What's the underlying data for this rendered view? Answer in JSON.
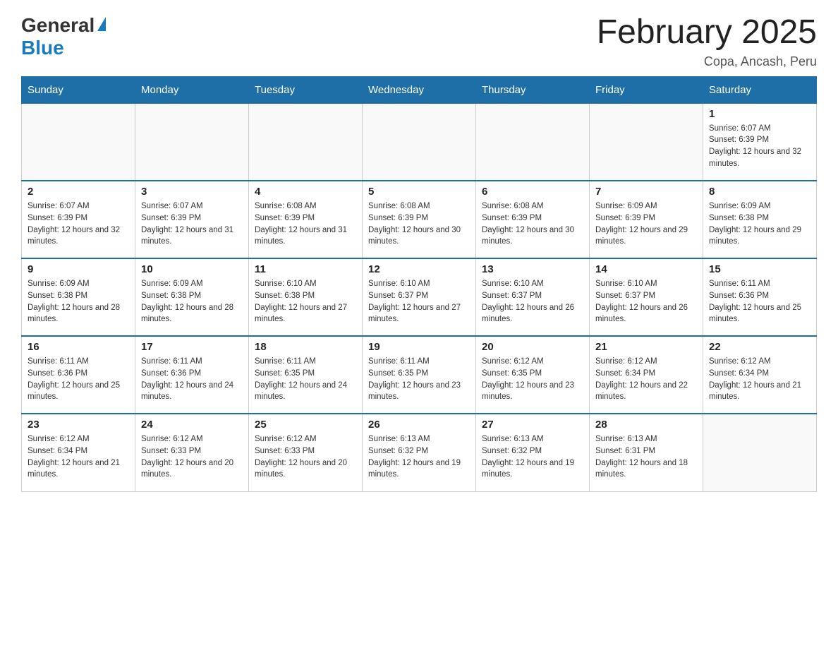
{
  "header": {
    "logo_general": "General",
    "logo_blue": "Blue",
    "month_title": "February 2025",
    "location": "Copa, Ancash, Peru"
  },
  "days_of_week": [
    "Sunday",
    "Monday",
    "Tuesday",
    "Wednesday",
    "Thursday",
    "Friday",
    "Saturday"
  ],
  "weeks": [
    [
      {
        "day": "",
        "info": ""
      },
      {
        "day": "",
        "info": ""
      },
      {
        "day": "",
        "info": ""
      },
      {
        "day": "",
        "info": ""
      },
      {
        "day": "",
        "info": ""
      },
      {
        "day": "",
        "info": ""
      },
      {
        "day": "1",
        "info": "Sunrise: 6:07 AM\nSunset: 6:39 PM\nDaylight: 12 hours and 32 minutes."
      }
    ],
    [
      {
        "day": "2",
        "info": "Sunrise: 6:07 AM\nSunset: 6:39 PM\nDaylight: 12 hours and 32 minutes."
      },
      {
        "day": "3",
        "info": "Sunrise: 6:07 AM\nSunset: 6:39 PM\nDaylight: 12 hours and 31 minutes."
      },
      {
        "day": "4",
        "info": "Sunrise: 6:08 AM\nSunset: 6:39 PM\nDaylight: 12 hours and 31 minutes."
      },
      {
        "day": "5",
        "info": "Sunrise: 6:08 AM\nSunset: 6:39 PM\nDaylight: 12 hours and 30 minutes."
      },
      {
        "day": "6",
        "info": "Sunrise: 6:08 AM\nSunset: 6:39 PM\nDaylight: 12 hours and 30 minutes."
      },
      {
        "day": "7",
        "info": "Sunrise: 6:09 AM\nSunset: 6:39 PM\nDaylight: 12 hours and 29 minutes."
      },
      {
        "day": "8",
        "info": "Sunrise: 6:09 AM\nSunset: 6:38 PM\nDaylight: 12 hours and 29 minutes."
      }
    ],
    [
      {
        "day": "9",
        "info": "Sunrise: 6:09 AM\nSunset: 6:38 PM\nDaylight: 12 hours and 28 minutes."
      },
      {
        "day": "10",
        "info": "Sunrise: 6:09 AM\nSunset: 6:38 PM\nDaylight: 12 hours and 28 minutes."
      },
      {
        "day": "11",
        "info": "Sunrise: 6:10 AM\nSunset: 6:38 PM\nDaylight: 12 hours and 27 minutes."
      },
      {
        "day": "12",
        "info": "Sunrise: 6:10 AM\nSunset: 6:37 PM\nDaylight: 12 hours and 27 minutes."
      },
      {
        "day": "13",
        "info": "Sunrise: 6:10 AM\nSunset: 6:37 PM\nDaylight: 12 hours and 26 minutes."
      },
      {
        "day": "14",
        "info": "Sunrise: 6:10 AM\nSunset: 6:37 PM\nDaylight: 12 hours and 26 minutes."
      },
      {
        "day": "15",
        "info": "Sunrise: 6:11 AM\nSunset: 6:36 PM\nDaylight: 12 hours and 25 minutes."
      }
    ],
    [
      {
        "day": "16",
        "info": "Sunrise: 6:11 AM\nSunset: 6:36 PM\nDaylight: 12 hours and 25 minutes."
      },
      {
        "day": "17",
        "info": "Sunrise: 6:11 AM\nSunset: 6:36 PM\nDaylight: 12 hours and 24 minutes."
      },
      {
        "day": "18",
        "info": "Sunrise: 6:11 AM\nSunset: 6:35 PM\nDaylight: 12 hours and 24 minutes."
      },
      {
        "day": "19",
        "info": "Sunrise: 6:11 AM\nSunset: 6:35 PM\nDaylight: 12 hours and 23 minutes."
      },
      {
        "day": "20",
        "info": "Sunrise: 6:12 AM\nSunset: 6:35 PM\nDaylight: 12 hours and 23 minutes."
      },
      {
        "day": "21",
        "info": "Sunrise: 6:12 AM\nSunset: 6:34 PM\nDaylight: 12 hours and 22 minutes."
      },
      {
        "day": "22",
        "info": "Sunrise: 6:12 AM\nSunset: 6:34 PM\nDaylight: 12 hours and 21 minutes."
      }
    ],
    [
      {
        "day": "23",
        "info": "Sunrise: 6:12 AM\nSunset: 6:34 PM\nDaylight: 12 hours and 21 minutes."
      },
      {
        "day": "24",
        "info": "Sunrise: 6:12 AM\nSunset: 6:33 PM\nDaylight: 12 hours and 20 minutes."
      },
      {
        "day": "25",
        "info": "Sunrise: 6:12 AM\nSunset: 6:33 PM\nDaylight: 12 hours and 20 minutes."
      },
      {
        "day": "26",
        "info": "Sunrise: 6:13 AM\nSunset: 6:32 PM\nDaylight: 12 hours and 19 minutes."
      },
      {
        "day": "27",
        "info": "Sunrise: 6:13 AM\nSunset: 6:32 PM\nDaylight: 12 hours and 19 minutes."
      },
      {
        "day": "28",
        "info": "Sunrise: 6:13 AM\nSunset: 6:31 PM\nDaylight: 12 hours and 18 minutes."
      },
      {
        "day": "",
        "info": ""
      }
    ]
  ]
}
